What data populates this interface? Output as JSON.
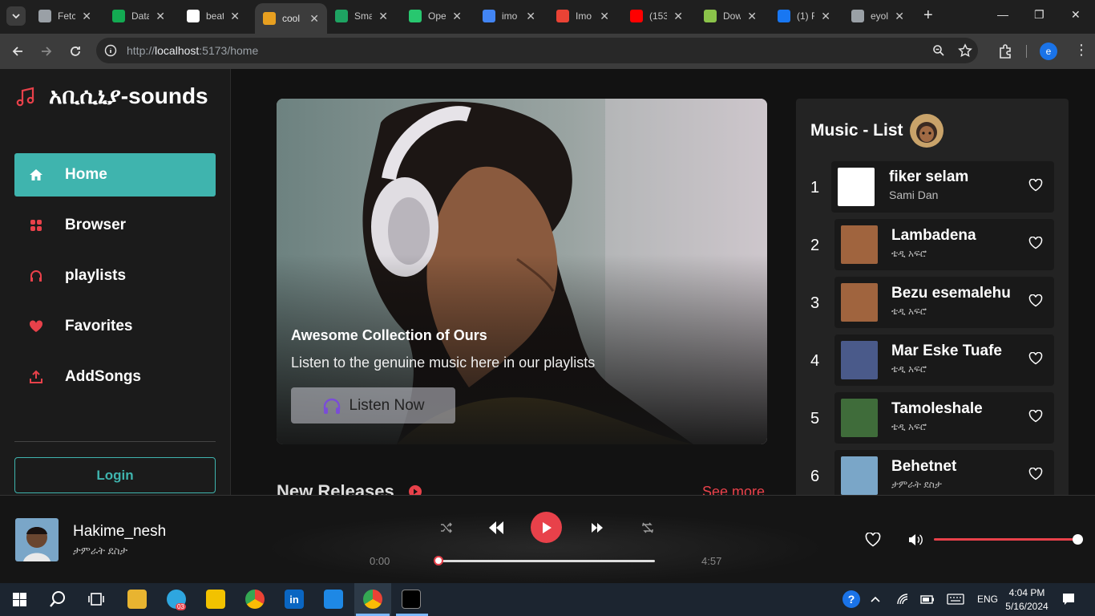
{
  "browser": {
    "tabs": [
      {
        "title": "Fetc",
        "icon": "settings-icon",
        "color": "#9aa0a6"
      },
      {
        "title": "Data",
        "icon": "mongodb-icon",
        "color": "#13aa52"
      },
      {
        "title": "beat",
        "icon": "github-icon",
        "color": "#ffffff"
      },
      {
        "title": "cool",
        "icon": "music-note-icon",
        "color": "#e8a020"
      },
      {
        "title": "Sma",
        "icon": "sheet-icon",
        "color": "#1ea362"
      },
      {
        "title": "Ope",
        "icon": "iqiyi-icon",
        "color": "#28c76f"
      },
      {
        "title": "imo",
        "icon": "google-icon",
        "color": "#4285f4"
      },
      {
        "title": "Imo",
        "icon": "gmail-icon",
        "color": "#ea4335"
      },
      {
        "title": "(153",
        "icon": "youtube-icon",
        "color": "#ff0000"
      },
      {
        "title": "Dow",
        "icon": "download-icon",
        "color": "#8bc34a"
      },
      {
        "title": "(1) F",
        "icon": "facebook-icon",
        "color": "#1877f2"
      },
      {
        "title": "eyol",
        "icon": "globe-icon",
        "color": "#9aa0a6"
      }
    ],
    "url_prefix": "http://",
    "url_host": "localhost",
    "url_path": ":5173/home",
    "profile_initial": "e"
  },
  "sidebar": {
    "brand": "አቢሲኒያ-sounds",
    "nav": [
      {
        "label": "Home",
        "icon": "home-icon"
      },
      {
        "label": "Browser",
        "icon": "grid-icon"
      },
      {
        "label": "playlists",
        "icon": "headphones-icon"
      },
      {
        "label": "Favorites",
        "icon": "heart-icon"
      },
      {
        "label": "AddSongs",
        "icon": "upload-icon"
      }
    ],
    "login_label": "Login"
  },
  "hero": {
    "title": "Awesome Collection of Ours",
    "subtitle": "Listen to the genuine music here in our playlists",
    "button_label": "Listen Now"
  },
  "releases": {
    "title": "New Releases",
    "see_more": "See more"
  },
  "playlist": {
    "title": "Music - List",
    "songs": [
      {
        "num": "1",
        "title": "fiker selam",
        "artist": "Sami Dan"
      },
      {
        "num": "2",
        "title": "Lambadena",
        "artist": "ቴዲ አፍሮ"
      },
      {
        "num": "3",
        "title": "Bezu esemalehu",
        "artist": "ቴዲ አፍሮ"
      },
      {
        "num": "4",
        "title": "Mar Eske Tuafe",
        "artist": "ቴዲ አፍሮ"
      },
      {
        "num": "5",
        "title": "Tamoleshale",
        "artist": "ቴዲ አፍሮ"
      },
      {
        "num": "6",
        "title": "Behetnet",
        "artist": "ታምራት ደስታ"
      }
    ]
  },
  "player": {
    "title": "Hakime_nesh",
    "artist": "ታምራት ደስታ",
    "elapsed": "0:00",
    "duration": "4:57",
    "progress": 0.0,
    "volume": 1.0
  },
  "taskbar": {
    "time": "4:04 PM",
    "date": "5/16/2024",
    "lang": "ENG",
    "telegram_badge": "03"
  },
  "colors": {
    "accent": "#3fb4ae",
    "red": "#e8414a"
  }
}
